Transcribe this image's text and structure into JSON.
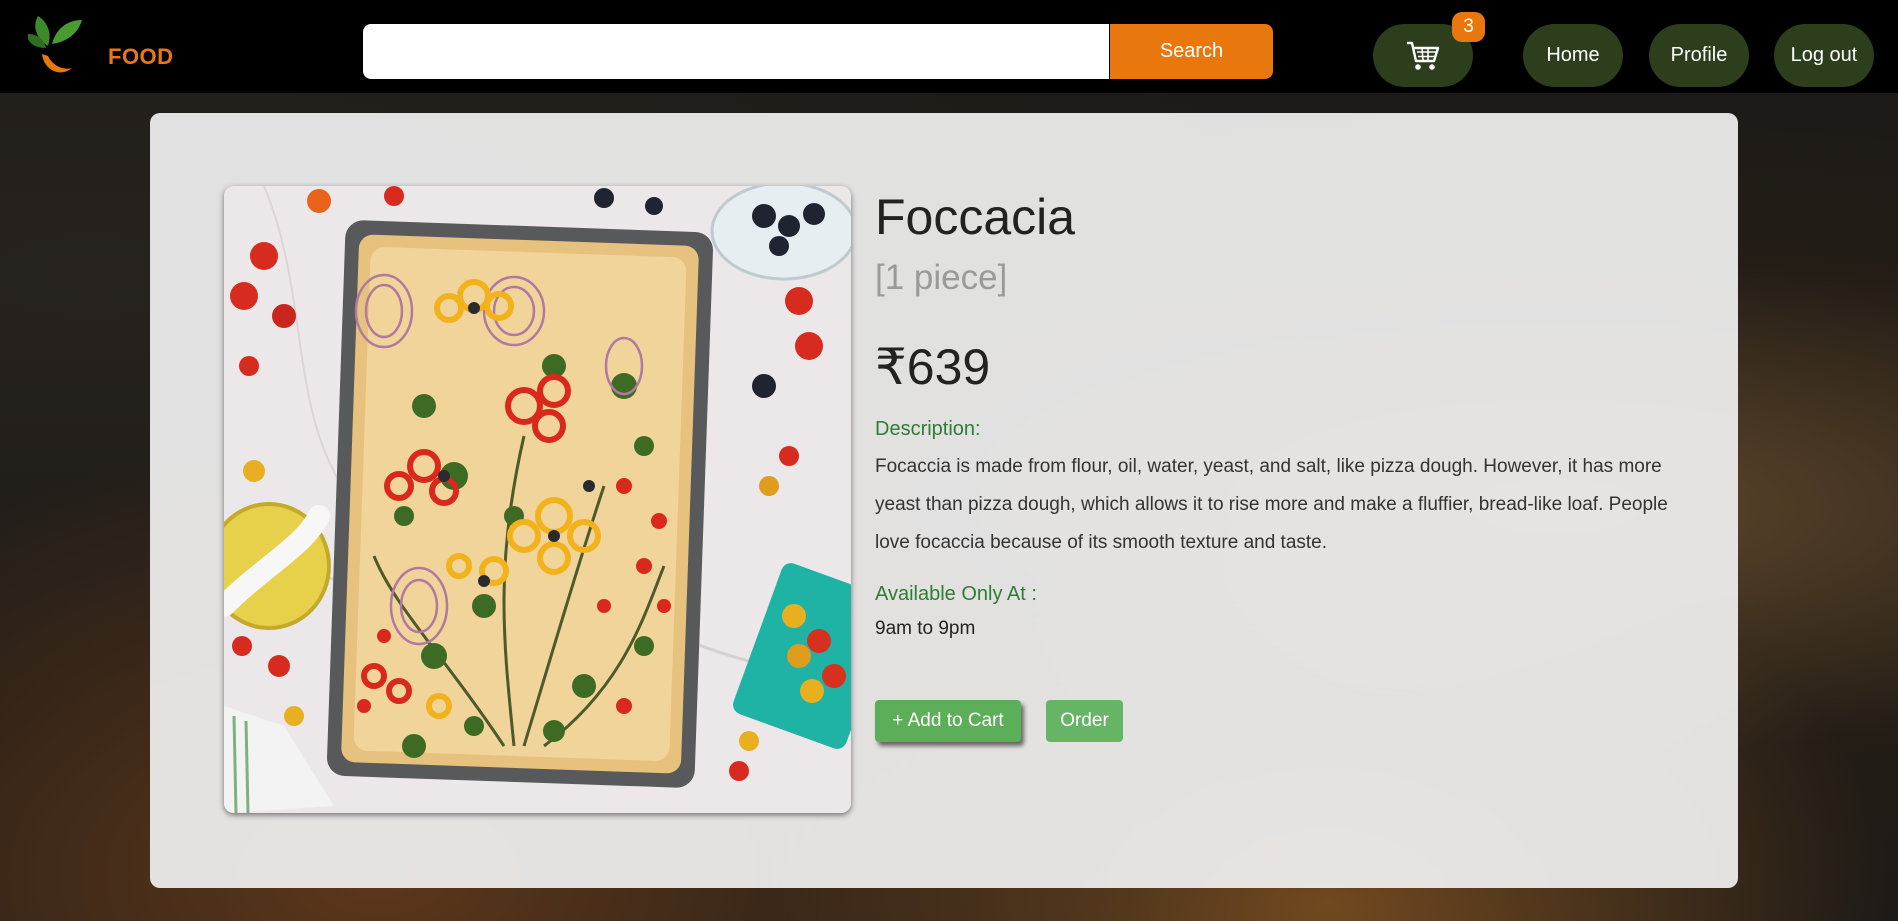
{
  "header": {
    "logo_text": "FOOD",
    "search": {
      "value": "",
      "placeholder": "",
      "button_label": "Search"
    },
    "cart_badge": "3",
    "nav": {
      "home": "Home",
      "profile": "Profile",
      "logout": "Log out"
    }
  },
  "product": {
    "name": "Foccacia",
    "quantity": "[1 piece]",
    "price": "₹639",
    "description_label": "Description:",
    "description": "Focaccia is made from flour, oil, water, yeast, and salt, like pizza dough. However, it has more yeast than pizza dough, which allows it to rise more and make a fluffier, bread-like loaf. People love focaccia because of its smooth texture and taste.",
    "availability_label": "Available Only At :",
    "availability": "9am to 9pm",
    "add_to_cart_label": "+ Add to Cart",
    "order_label": "Order"
  },
  "colors": {
    "accent": "#e8770d",
    "nav_pill": "#2c3e1c",
    "green_label": "#2e7d32",
    "button_green": "#5cae58"
  }
}
